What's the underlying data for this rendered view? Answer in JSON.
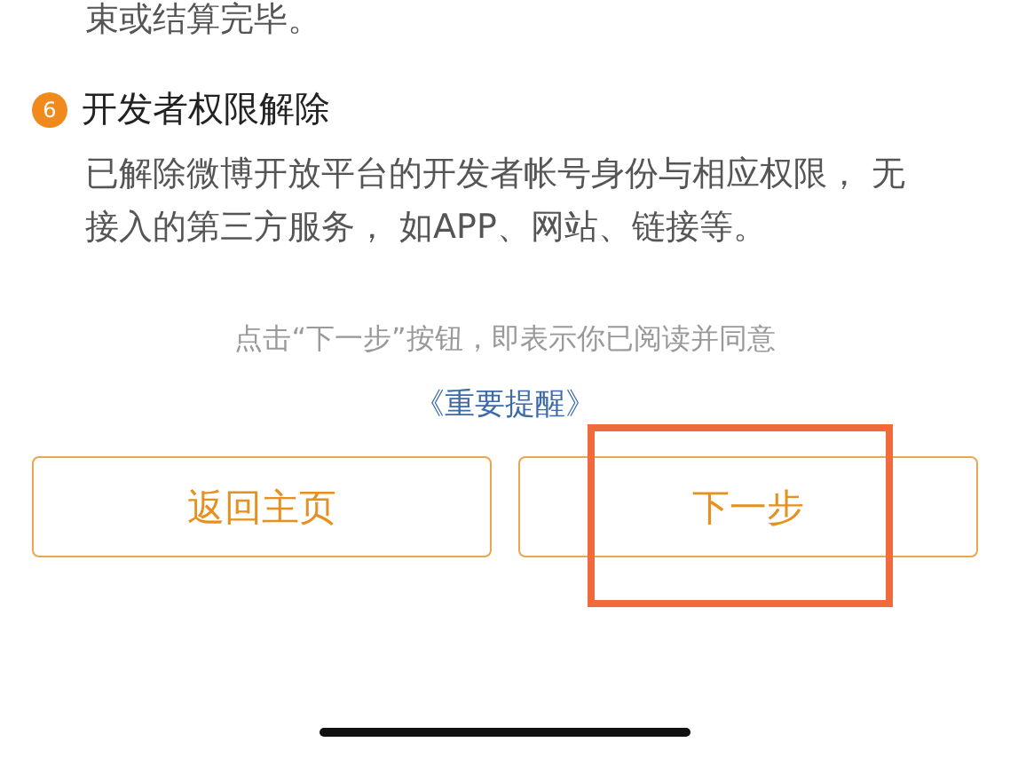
{
  "previous_text": "束或结算完毕。",
  "item": {
    "number": "6",
    "title": "开发者权限解除",
    "description": "已解除微博开放平台的开发者帐号身份与相应权限， 无接入的第三方服务， 如APP、网站、链接等。"
  },
  "consent": "点击“下一步”按钮，即表示你已阅读并同意",
  "link": "《重要提醒》",
  "buttons": [
    {
      "label": "返回主页",
      "highlighted": false
    },
    {
      "label": "下一步",
      "highlighted": true
    }
  ]
}
